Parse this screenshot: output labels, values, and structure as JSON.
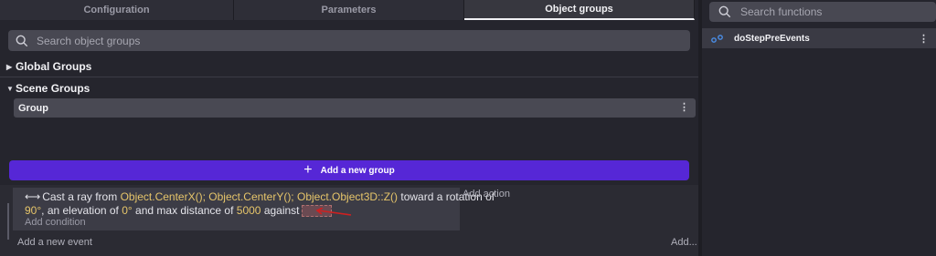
{
  "tabs": [
    {
      "label": "Configuration"
    },
    {
      "label": "Parameters"
    },
    {
      "label": "Object groups"
    }
  ],
  "groups_search": {
    "placeholder": "Search object groups"
  },
  "global_groups": {
    "label": "Global Groups"
  },
  "scene_groups": {
    "label": "Scene Groups",
    "items": [
      {
        "label": "Group"
      }
    ]
  },
  "add_group": {
    "label": "Add a new group"
  },
  "event": {
    "line1": {
      "prefix": "Cast a ray from ",
      "arg1": "Object.CenterX();",
      "arg2": "Object.CenterY();",
      "arg3": "Object.Object3D::Z()",
      "suffix": " toward a rotation of"
    },
    "line2": {
      "arg1": "90°",
      "text1": ", an elevation of ",
      "arg2": "0°",
      "text2": " and max distance of ",
      "arg3": "5000",
      "text3": " against"
    },
    "add_condition": "Add condition",
    "add_action": "Add action"
  },
  "add_event": "Add a new event",
  "add_more": "Add...",
  "functions_search": {
    "placeholder": "Search functions"
  },
  "functions": [
    {
      "label": "doStepPreEvents"
    }
  ],
  "colors": {
    "accent": "#5627d6",
    "highlight_arg": "#e6c56a",
    "annotation_arrow": "#d02020"
  }
}
